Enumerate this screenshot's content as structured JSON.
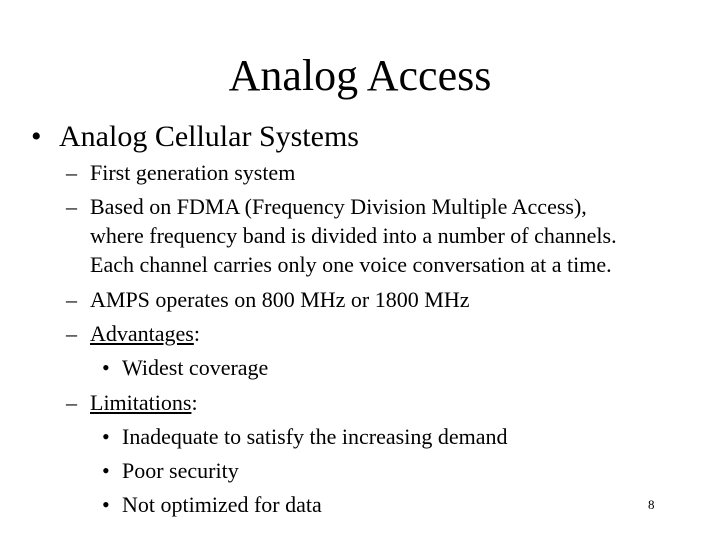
{
  "slide": {
    "title": "Analog Access",
    "bullet_glyph": "•",
    "dash_glyph": "–",
    "level1": {
      "text": "Analog Cellular Systems"
    },
    "items": {
      "first_generation": "First generation system",
      "fdma_line1": "Based on FDMA (Frequency Division Multiple Access),",
      "fdma_line2": "where frequency band is divided into a number of channels.",
      "fdma_line3": "Each channel carries only one voice conversation at a time.",
      "amps": "AMPS operates on 800 MHz or 1800 MHz",
      "advantages_label": "Advantages",
      "advantages_colon": ":",
      "advantages": [
        "Widest coverage"
      ],
      "limitations_label": "Limitations",
      "limitations_colon": ":",
      "limitations": [
        "Inadequate to satisfy the increasing demand",
        "Poor security",
        "Not optimized for data"
      ]
    },
    "page_number": "8"
  }
}
